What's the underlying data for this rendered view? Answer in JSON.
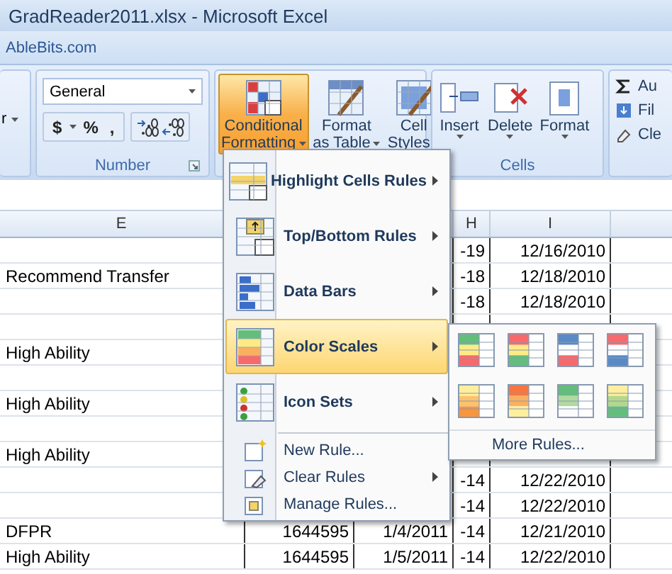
{
  "window": {
    "title": "GradReader2011.xlsx - Microsoft Excel"
  },
  "tab_strip": {
    "label": "AbleBits.com"
  },
  "ribbon": {
    "left_partial": {
      "label": "r"
    },
    "number_group": {
      "format": "General",
      "buttons": [
        "$",
        "%",
        ","
      ],
      "label": "Number"
    },
    "styles_buttons": [
      {
        "lines": [
          "Conditional",
          "Formatting"
        ],
        "selected": true
      },
      {
        "lines": [
          "Format",
          "as Table"
        ],
        "selected": false
      },
      {
        "lines": [
          "Cell",
          "Styles"
        ],
        "selected": false
      }
    ],
    "cells_group": {
      "buttons": [
        "Insert",
        "Delete",
        "Format"
      ],
      "label": "Cells"
    },
    "editing_group": {
      "items": [
        "Au",
        "Fil",
        "Cle"
      ]
    }
  },
  "sheet": {
    "column_headers": {
      "e": "E",
      "h": "H",
      "i": "I"
    },
    "rows": [
      {
        "e": "",
        "f": "",
        "g": "",
        "h": "-19",
        "i": "12/16/2010"
      },
      {
        "e": "Recommend Transfer",
        "f": "",
        "g": "",
        "h": "-18",
        "i": "12/18/2010"
      },
      {
        "e": "",
        "f": "",
        "g": "",
        "h": "-18",
        "i": "12/18/2010"
      },
      {
        "e": "",
        "f": "",
        "g": "",
        "h": "",
        "i": ""
      },
      {
        "e": "High Ability",
        "f": "",
        "g": "",
        "h": "",
        "i": ""
      },
      {
        "e": "",
        "f": "",
        "g": "",
        "h": "",
        "i": ""
      },
      {
        "e": "High Ability",
        "f": "",
        "g": "",
        "h": "",
        "i": ""
      },
      {
        "e": "",
        "f": "",
        "g": "",
        "h": "",
        "i": ""
      },
      {
        "e": "High Ability",
        "f": "",
        "g": "",
        "h": "",
        "i": ""
      },
      {
        "e": "",
        "f": "",
        "g": "",
        "h": "-14",
        "i": "12/22/2010"
      },
      {
        "e": "",
        "f": "",
        "g": "",
        "h": "-14",
        "i": "12/22/2010"
      },
      {
        "e": "DFPR",
        "f": "1644595",
        "g": "1/4/2011",
        "h": "-14",
        "i": "12/21/2010"
      },
      {
        "e": "High Ability",
        "f": "1644595",
        "g": "1/5/2011",
        "h": "-14",
        "i": "12/22/2010"
      }
    ]
  },
  "menu": {
    "items": [
      {
        "kind": "large",
        "label": "Highlight Cells Rules",
        "submenu": true,
        "selected": false
      },
      {
        "kind": "large",
        "label": "Top/Bottom Rules",
        "submenu": true,
        "selected": false
      },
      {
        "kind": "large",
        "label": "Data Bars",
        "submenu": true,
        "selected": false
      },
      {
        "kind": "large",
        "label": "Color Scales",
        "submenu": true,
        "selected": true
      },
      {
        "kind": "large",
        "label": "Icon Sets",
        "submenu": true,
        "selected": false
      },
      {
        "kind": "small",
        "label": "New Rule...",
        "submenu": false,
        "selected": false
      },
      {
        "kind": "small",
        "label": "Clear Rules",
        "submenu": true,
        "selected": false
      },
      {
        "kind": "small",
        "label": "Manage Rules...",
        "submenu": false,
        "selected": false
      }
    ]
  },
  "submenu": {
    "scales": [
      {
        "bands": [
          {
            "color": "#63be7b"
          },
          {
            "color": "#ffeb84"
          },
          {
            "color": "#f8696b"
          }
        ]
      },
      {
        "bands": [
          {
            "color": "#f8696b"
          },
          {
            "color": "#ffeb84"
          },
          {
            "color": "#63be7b"
          }
        ]
      },
      {
        "bands": [
          {
            "color": "#5a8ac6"
          },
          {
            "color": "#fcfcff"
          },
          {
            "color": "#f8696b"
          }
        ]
      },
      {
        "bands": [
          {
            "color": "#f8696b"
          },
          {
            "color": "#fcfcff"
          },
          {
            "color": "#5a8ac6"
          }
        ]
      },
      {
        "bands": [
          {
            "color": "#ffef9c"
          },
          {
            "color": "#fcc26e"
          },
          {
            "color": "#f8963e"
          }
        ]
      },
      {
        "bands": [
          {
            "color": "#f8763e"
          },
          {
            "color": "#fbb060"
          },
          {
            "color": "#ffef9c"
          }
        ]
      },
      {
        "bands": [
          {
            "color": "#63be7b"
          },
          {
            "color": "#b1d9a0"
          },
          {
            "color": "#fcfcff"
          }
        ]
      },
      {
        "bands": [
          {
            "color": "#ffef9c"
          },
          {
            "color": "#b4d88a"
          },
          {
            "color": "#63be7b"
          }
        ]
      }
    ],
    "more": "More Rules..."
  }
}
